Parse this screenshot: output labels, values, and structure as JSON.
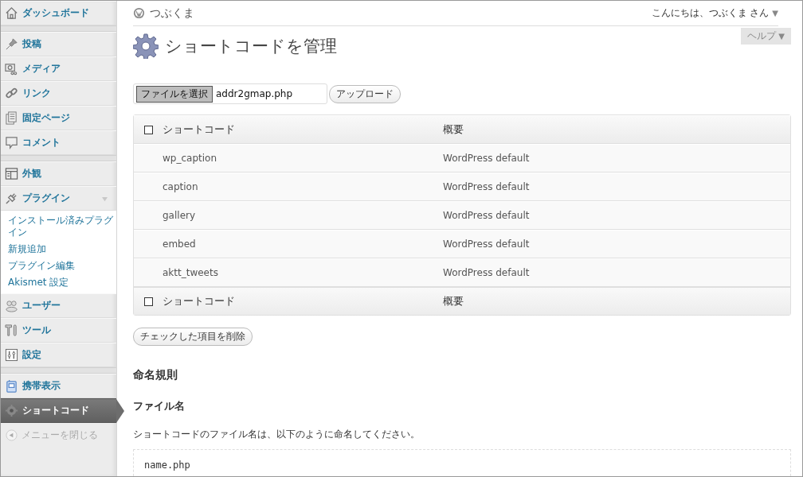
{
  "sidebar": {
    "groups": [
      [
        {
          "label": "ダッシュボード",
          "selected": false
        }
      ],
      [
        {
          "label": "投稿",
          "selected": false
        },
        {
          "label": "メディア",
          "selected": false
        },
        {
          "label": "リンク",
          "selected": false
        },
        {
          "label": "固定ページ",
          "selected": false
        },
        {
          "label": "コメント",
          "selected": false
        }
      ],
      [
        {
          "label": "外観",
          "selected": false
        },
        {
          "label": "プラグイン",
          "selected": false,
          "expanded": true,
          "children": [
            {
              "label": "インストール済みプラグイン"
            },
            {
              "label": "新規追加"
            },
            {
              "label": "プラグイン編集"
            },
            {
              "label": "Akismet 設定"
            }
          ]
        },
        {
          "label": "ユーザー",
          "selected": false
        },
        {
          "label": "ツール",
          "selected": false
        },
        {
          "label": "設定",
          "selected": false
        }
      ],
      [
        {
          "label": "携帯表示",
          "selected": false
        },
        {
          "label": "ショートコード",
          "selected": true
        }
      ]
    ],
    "collapse": "メニューを閉じる"
  },
  "site_name": "つぶくま",
  "greeting": "こんにちは、つぶくま さん",
  "greeting_caret": "▼",
  "help": "ヘルプ",
  "help_caret": "▼",
  "page_title": "ショートコードを管理",
  "upload": {
    "choose_button": "ファイルを選択",
    "file_name": "addr2gmap.php",
    "upload_button": "アップロード"
  },
  "table": {
    "columns": [
      "ショートコード",
      "概要"
    ],
    "footer_columns": [
      "ショートコード",
      "概要"
    ],
    "header_checked": false,
    "footer_checked": false,
    "rows": [
      {
        "name": "wp_caption",
        "description": "WordPress default"
      },
      {
        "name": "caption",
        "description": "WordPress default"
      },
      {
        "name": "gallery",
        "description": "WordPress default"
      },
      {
        "name": "embed",
        "description": "WordPress default"
      },
      {
        "name": "aktt_tweets",
        "description": "WordPress default"
      }
    ]
  },
  "delete_button": "チェックした項目を削除",
  "naming": {
    "heading": "命名規則",
    "subheading": "ファイル名",
    "paragraph": "ショートコードのファイル名は、以下のように命名してください。",
    "code": "name.php"
  }
}
